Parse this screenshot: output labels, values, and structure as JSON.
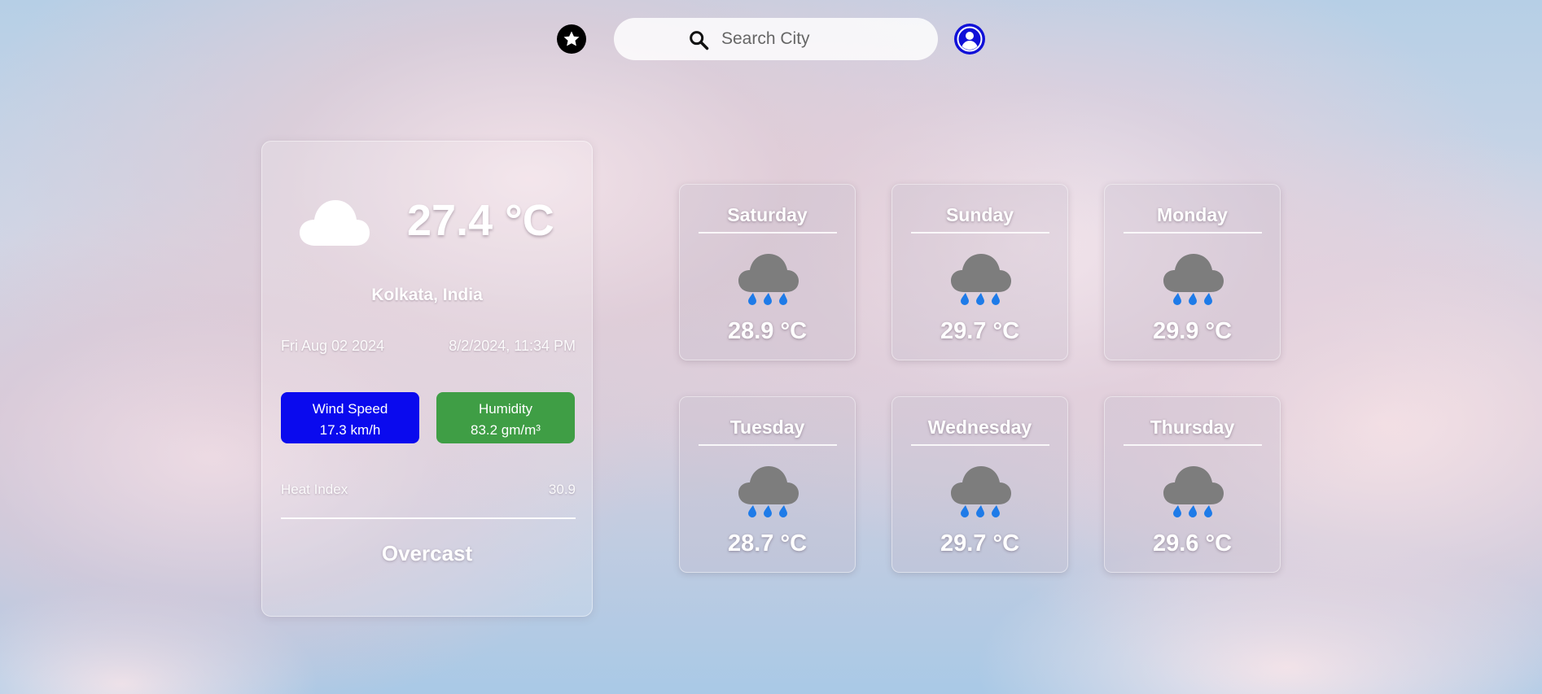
{
  "header": {
    "search": {
      "placeholder": "Search City",
      "value": ""
    },
    "favorites_icon": "star-icon",
    "profile_icon": "user-icon"
  },
  "current": {
    "icon": "cloud-icon",
    "temperature": "27.4 °C",
    "location": "Kolkata, India",
    "date": "Fri Aug 02 2024",
    "datetime": "8/2/2024, 11:34 PM",
    "wind": {
      "label": "Wind Speed",
      "value": "17.3 km/h",
      "color": "#0a0aee"
    },
    "humidity": {
      "label": "Humidity",
      "value": "83.2 gm/m³",
      "color": "#3f9e45"
    },
    "heat_index": {
      "label": "Heat Index",
      "value": "30.9"
    },
    "condition": "Overcast"
  },
  "forecast": [
    {
      "day": "Saturday",
      "temp": "28.9 °C",
      "icon": "rain-cloud-icon"
    },
    {
      "day": "Sunday",
      "temp": "29.7 °C",
      "icon": "rain-cloud-icon"
    },
    {
      "day": "Monday",
      "temp": "29.9 °C",
      "icon": "rain-cloud-icon"
    },
    {
      "day": "Tuesday",
      "temp": "28.7 °C",
      "icon": "rain-cloud-icon"
    },
    {
      "day": "Wednesday",
      "temp": "29.7 °C",
      "icon": "rain-cloud-icon"
    },
    {
      "day": "Thursday",
      "temp": "29.6 °C",
      "icon": "rain-cloud-icon"
    }
  ]
}
